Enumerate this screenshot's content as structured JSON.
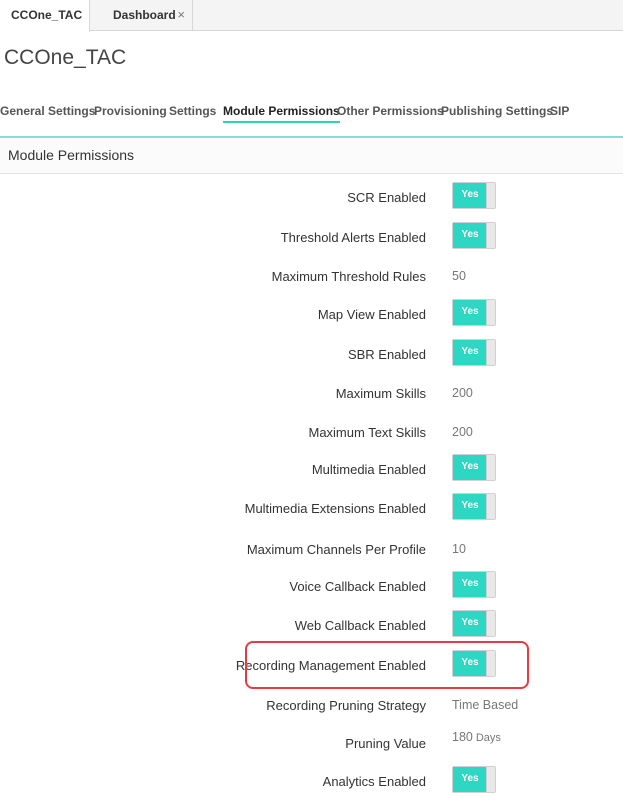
{
  "tabs": [
    {
      "label": "CCOne_TAC"
    },
    {
      "label": "Dashboard",
      "close": "×"
    }
  ],
  "page": {
    "title": "CCOne_TAC"
  },
  "subnav": [
    {
      "label": "General Settings"
    },
    {
      "label": "Provisioning"
    },
    {
      "label": "Settings"
    },
    {
      "label": "Module Permissions",
      "active": true
    },
    {
      "label": "Other Permissions"
    },
    {
      "label": "Publishing Settings"
    },
    {
      "label": "SIP"
    }
  ],
  "section": {
    "title": "Module Permissions"
  },
  "rows": [
    {
      "label": "SCR Enabled",
      "toggle": "Yes"
    },
    {
      "label": "Threshold Alerts Enabled",
      "toggle": "Yes"
    },
    {
      "label": "Maximum Threshold Rules",
      "value": "50"
    },
    {
      "label": "Map View Enabled",
      "toggle": "Yes"
    },
    {
      "label": "SBR Enabled",
      "toggle": "Yes"
    },
    {
      "label": "Maximum Skills",
      "value": "200"
    },
    {
      "label": "Maximum Text Skills",
      "value": "200"
    },
    {
      "label": "Multimedia Enabled",
      "toggle": "Yes"
    },
    {
      "label": "Multimedia Extensions Enabled",
      "toggle": "Yes"
    },
    {
      "label": "Maximum Channels Per Profile",
      "value": "10"
    },
    {
      "label": "Voice Callback Enabled",
      "toggle": "Yes"
    },
    {
      "label": "Web Callback Enabled",
      "toggle": "Yes"
    },
    {
      "label": "Recording Management Enabled",
      "toggle": "Yes"
    },
    {
      "label": "Recording Pruning Strategy",
      "value": "Time Based"
    },
    {
      "label": "Pruning Value",
      "value": "180",
      "unit": "Days"
    },
    {
      "label": "Analytics Enabled",
      "toggle": "Yes"
    }
  ],
  "colors": {
    "accent": "#2ed6c4",
    "highlight": "#e53c42"
  }
}
